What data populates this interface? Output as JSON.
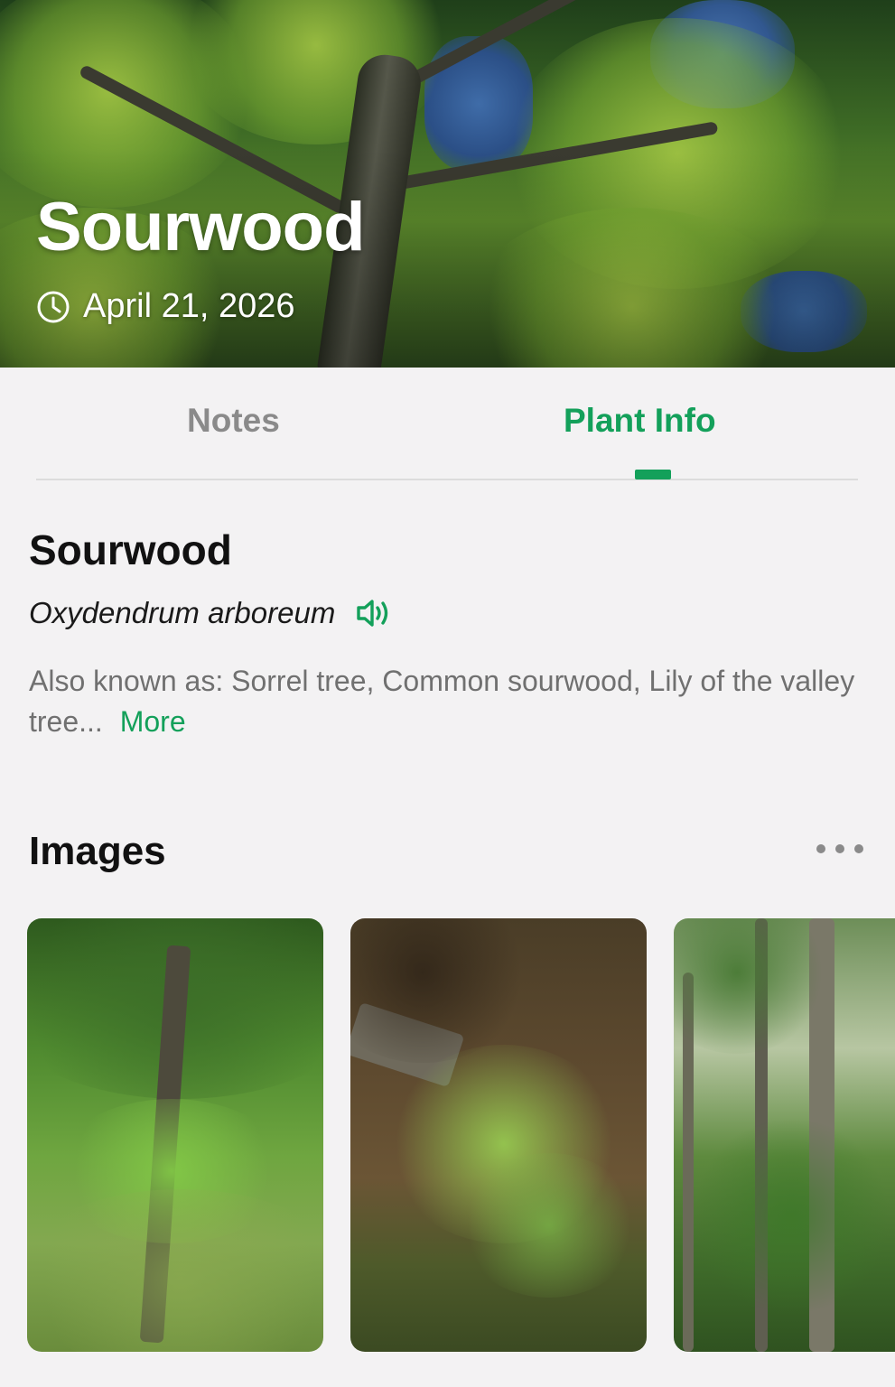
{
  "header": {
    "title": "Sourwood",
    "date": "April 21, 2026"
  },
  "tabs": [
    {
      "label": "Notes",
      "active": false
    },
    {
      "label": "Plant Info",
      "active": true
    }
  ],
  "plant": {
    "common_name": "Sourwood",
    "scientific_name": "Oxydendrum arboreum",
    "also_known_as": "Also known as: Sorrel tree, Common sourwood, Lily of the valley tree...",
    "more_label": "More"
  },
  "images_section": {
    "title": "Images",
    "count_visible": 3
  },
  "colors": {
    "accent": "#13a05a",
    "background": "#f3f2f3",
    "inactive_tab": "#8a8a8a",
    "body_text": "#707070"
  }
}
